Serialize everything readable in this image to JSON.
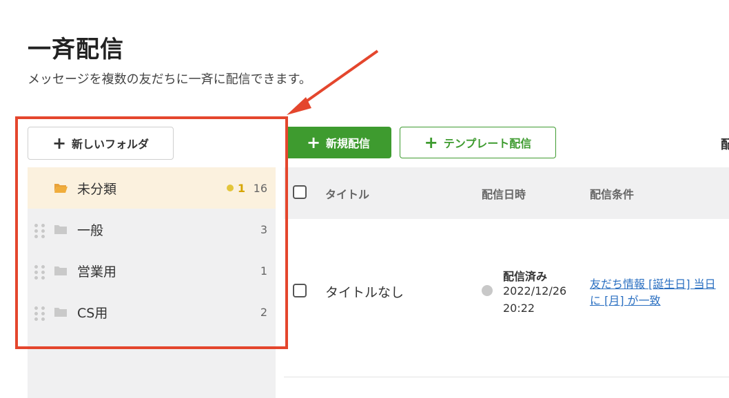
{
  "page": {
    "title": "一斉配信",
    "description": "メッセージを複数の友だちに一斉に配信できます。"
  },
  "sidebar": {
    "new_folder_label": "新しいフォルダ",
    "folders": [
      {
        "name": "未分類",
        "unread": "1",
        "count": "16",
        "selected": true
      },
      {
        "name": "一般",
        "count": "3"
      },
      {
        "name": "営業用",
        "count": "1"
      },
      {
        "name": "CS用",
        "count": "2"
      }
    ]
  },
  "toolbar": {
    "new_broadcast_label": "新規配信",
    "template_broadcast_label": "テンプレート配信",
    "cut_off_label": "配"
  },
  "table": {
    "headers": {
      "title": "タイトル",
      "date": "配信日時",
      "condition": "配信条件"
    },
    "rows": [
      {
        "title": "タイトルなし",
        "status": "配信済み",
        "date": "2022/12/26",
        "time": "20:22",
        "condition_line1": "友だち情報 [誕生日] 当日",
        "condition_line2": "に [月] が一致"
      }
    ]
  },
  "colors": {
    "accent_green": "#3e9b2f",
    "highlight_red": "#e4462d",
    "link_blue": "#2a6fc1",
    "unread_yellow": "#e3c53a"
  }
}
